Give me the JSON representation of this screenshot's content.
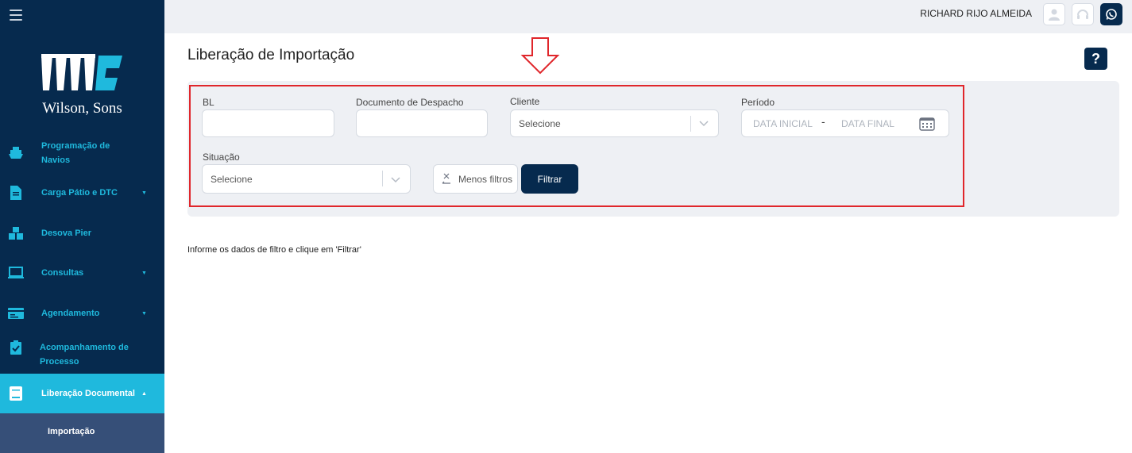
{
  "brand": {
    "name": "Wilson, Sons",
    "primary": "#062a4e",
    "accent": "#1fb9dd"
  },
  "sidebar": {
    "menu_icon": "hamburger-icon",
    "items": [
      {
        "label": "Programação de Navios",
        "icon": "ship-icon",
        "has_caret": false
      },
      {
        "label": "Carga Pátio e DTC",
        "icon": "document-icon",
        "has_caret": true
      },
      {
        "label": "Desova Pier",
        "icon": "boxes-icon",
        "has_caret": false
      },
      {
        "label": "Consultas",
        "icon": "monitor-icon",
        "has_caret": true
      },
      {
        "label": "Agendamento",
        "icon": "card-icon",
        "has_caret": true
      },
      {
        "label": "Acompanhamento de Processo",
        "icon": "clipboard-check-icon",
        "has_caret": false
      },
      {
        "label": "Liberação Documental",
        "icon": "book-icon",
        "has_caret": true,
        "active": true
      }
    ],
    "subitem": "Importação"
  },
  "topbar": {
    "user_name": "RICHARD RIJO ALMEIDA",
    "icons": [
      "user-icon",
      "headset-icon",
      "whatsapp-icon"
    ]
  },
  "main": {
    "title": "Liberação de Importação",
    "help_label": "?",
    "filters": {
      "bl": {
        "label": "BL",
        "value": ""
      },
      "documento": {
        "label": "Documento de Despacho",
        "value": ""
      },
      "cliente": {
        "label": "Cliente",
        "placeholder": "Selecione"
      },
      "periodo": {
        "label": "Período",
        "start_placeholder": "DATA INICIAL",
        "separator": "-",
        "end_placeholder": "DATA FINAL"
      },
      "situacao": {
        "label": "Situação",
        "placeholder": "Selecione"
      }
    },
    "buttons": {
      "less_filters": "Menos filtros",
      "filter": "Filtrar"
    },
    "info": "Informe os dados de filtro e clique em 'Filtrar'"
  }
}
